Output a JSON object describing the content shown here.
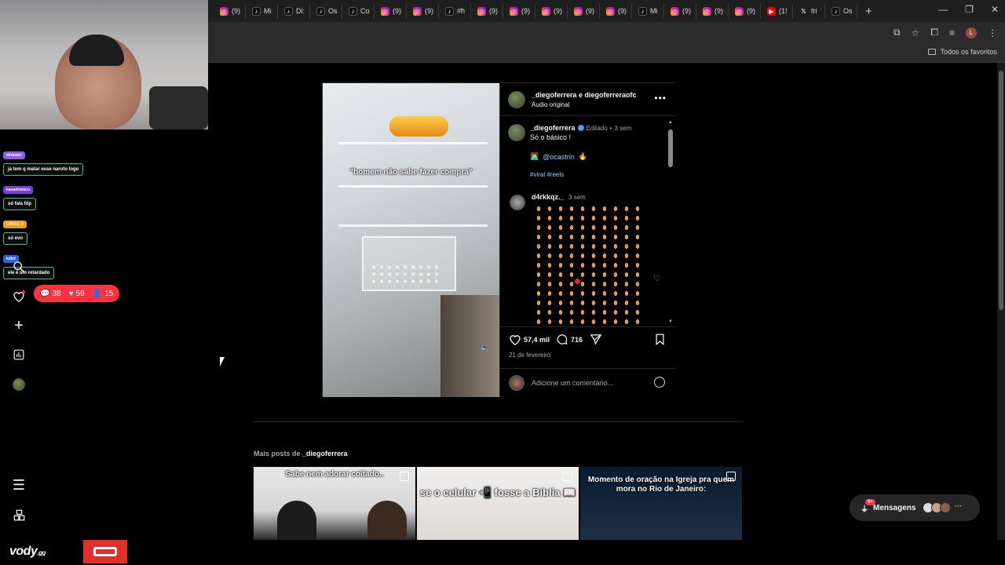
{
  "browser": {
    "tabs": [
      {
        "icon": "instagram",
        "label": "(9)"
      },
      {
        "icon": "tiktok",
        "label": "Mi"
      },
      {
        "icon": "tiktok",
        "label": "Di:"
      },
      {
        "icon": "tiktok",
        "label": "Os"
      },
      {
        "icon": "tiktok",
        "label": "Co"
      },
      {
        "icon": "instagram",
        "label": "(9)"
      },
      {
        "icon": "instagram",
        "label": "(9)"
      },
      {
        "icon": "tiktok",
        "label": "#ħ"
      },
      {
        "icon": "instagram",
        "label": "(9)"
      },
      {
        "icon": "instagram",
        "label": "(9)"
      },
      {
        "icon": "instagram",
        "label": "(9)"
      },
      {
        "icon": "instagram",
        "label": "(9)"
      },
      {
        "icon": "instagram",
        "label": "(9)"
      },
      {
        "icon": "tiktok",
        "label": "Mi"
      },
      {
        "icon": "instagram",
        "label": "(9)"
      },
      {
        "icon": "instagram",
        "label": "(9)"
      },
      {
        "icon": "instagram",
        "label": "(9)"
      },
      {
        "icon": "youtube",
        "label": "(1!"
      },
      {
        "icon": "x",
        "label": "fri"
      },
      {
        "icon": "tiktok",
        "label": "Os"
      }
    ],
    "new_tab": "+",
    "bookmarks_folder": "Todos os favoritos",
    "profile_initial": "L"
  },
  "chat": [
    {
      "user": "alrauanr",
      "user_color": "#8d5cf6",
      "text": "ja tem q matar esse naruto logo"
    },
    {
      "user": "kauadowaco",
      "user_color": "#7c3aed",
      "text": "só fala fdp"
    },
    {
      "user": "LMK01_0",
      "user_color": "#f59e0b",
      "text": "só evo"
    },
    {
      "user": "kdkd",
      "user_color": "#2563eb",
      "text": "ele é um retardado"
    }
  ],
  "sidebar": {
    "notifications": {
      "comments": "38",
      "likes": "59",
      "follows": "15"
    }
  },
  "post": {
    "reel_caption": "\"homem não sabe fazer compra\"",
    "header_names": "_diegoferrera e diegoferreraofc",
    "header_audio": "Áudio original",
    "caption": {
      "username": "_diegoferrera",
      "edited": "Editado",
      "time": "3 sem",
      "text": "Só o básico !",
      "mention": "@ocastrin",
      "hashtags": "#viral #reels"
    },
    "comment": {
      "username": "d4rkkqz._",
      "time": "3 sem"
    },
    "likes": "57,4 mil",
    "comments_count": "716",
    "date": "21 de fevereiro",
    "add_comment_placeholder": "Adicione um comentário..."
  },
  "more_posts": {
    "prefix": "Mais posts de",
    "username": "_diegoferrera",
    "thumbnails": [
      {
        "text": "Sabe nem adorar coitado.."
      },
      {
        "text": "se o celular 📲 fosse a Bíblia 📖"
      },
      {
        "text": "Momento de oração na Igreja pra quem mora no Rio de Janeiro:"
      }
    ]
  },
  "messages": {
    "label": "Mensagens",
    "badge": "9+"
  },
  "stream": {
    "brand": "vody",
    "brand_suffix": ".gg"
  },
  "colors": {
    "accent_red": "#ff3040",
    "link_blue": "#a7c7ff",
    "verified": "#3897f0"
  }
}
